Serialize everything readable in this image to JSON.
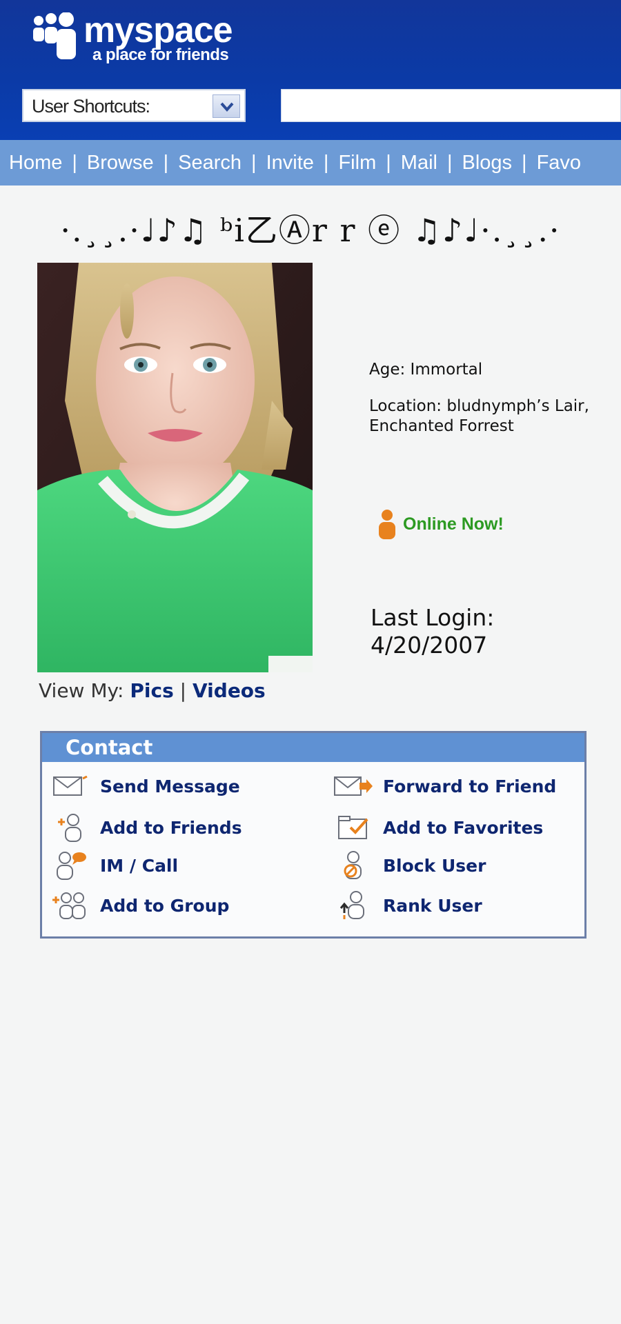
{
  "header": {
    "logo_word": "myspace",
    "logo_tagline": "a place for friends",
    "shortcuts_label": "User Shortcuts:"
  },
  "nav": {
    "items": [
      "Home",
      "Browse",
      "Search",
      "Invite",
      "Film",
      "Mail",
      "Blogs",
      "Favo"
    ]
  },
  "profile": {
    "name": "·.¸¸.·♩♪♫ ᵇi乙Ⓐr r ⓔ ♫♪♩·.¸¸.·",
    "age_label": "Age: Immortal",
    "location_line1": "Location: bludnymph’s Lair,",
    "location_line2": "Enchanted Forrest",
    "online_status": "Online Now!",
    "last_login_label": "Last Login:",
    "last_login_date": "4/20/2007",
    "view_my_label": "View My: ",
    "view_pics": "Pics",
    "view_sep": " | ",
    "view_videos": "Videos"
  },
  "contact": {
    "title": "Contact",
    "items": [
      {
        "label": "Send Message",
        "icon": "envelope-icon"
      },
      {
        "label": "Forward to Friend",
        "icon": "forward-envelope-icon"
      },
      {
        "label": "Add to Friends",
        "icon": "add-friend-icon"
      },
      {
        "label": "Add to Favorites",
        "icon": "favorites-folder-icon"
      },
      {
        "label": "IM / Call",
        "icon": "chat-user-icon"
      },
      {
        "label": "Block User",
        "icon": "block-user-icon"
      },
      {
        "label": "Add to Group",
        "icon": "add-group-icon"
      },
      {
        "label": "Rank User",
        "icon": "rank-user-icon"
      }
    ]
  },
  "colors": {
    "header_blue": "#0b3aa6",
    "nav_blue": "#6d9bd6",
    "link_navy": "#0e2670",
    "online_green": "#2c9a22",
    "accent_orange": "#e8821e"
  }
}
